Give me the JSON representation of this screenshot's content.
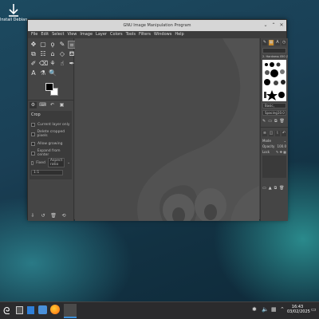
{
  "desktop": {
    "installer_label": "Install Debian"
  },
  "window": {
    "title": "GNU Image Manipulation Program",
    "controls": {
      "minimize": "⌄",
      "maximize": "⌃",
      "close": "✕"
    }
  },
  "menubar": {
    "items": [
      "File",
      "Edit",
      "Select",
      "View",
      "Image",
      "Layer",
      "Colors",
      "Tools",
      "Filters",
      "Windows",
      "Help"
    ]
  },
  "toolbox": {
    "tools": [
      {
        "icon": "move-icon",
        "glyph": "✥"
      },
      {
        "icon": "rect-select-icon",
        "glyph": "▢"
      },
      {
        "icon": "lasso-icon",
        "glyph": "ϙ"
      },
      {
        "icon": "fuzzy-select-icon",
        "glyph": "✎"
      },
      {
        "icon": "crop-icon",
        "glyph": "⌗",
        "active": true
      },
      {
        "icon": "unified-transform-icon",
        "glyph": "⧉"
      },
      {
        "icon": "warp-icon",
        "glyph": "☷"
      },
      {
        "icon": "cage-icon",
        "glyph": "⌂"
      },
      {
        "icon": "perspective-icon",
        "glyph": "◇"
      },
      {
        "icon": "bucket-fill-icon",
        "glyph": "⛾"
      },
      {
        "icon": "paintbrush-icon",
        "glyph": "✐"
      },
      {
        "icon": "eraser-icon",
        "glyph": "⌫"
      },
      {
        "icon": "clone-icon",
        "glyph": "⚘"
      },
      {
        "icon": "smudge-icon",
        "glyph": "☝"
      },
      {
        "icon": "paths-icon",
        "glyph": "✒"
      },
      {
        "icon": "text-icon",
        "glyph": "A"
      },
      {
        "icon": "color-picker-icon",
        "glyph": "⚗"
      },
      {
        "icon": "zoom-icon",
        "glyph": "🔍"
      }
    ],
    "fg_color": "#000000",
    "bg_color": "#ffffff",
    "tool_options": {
      "title": "Crop",
      "options": [
        "Current layer only",
        "Delete cropped pixels",
        "Allow growing",
        "Expand from center"
      ],
      "fixed_label": "Fixed",
      "fixed_value": "Aspect ratio",
      "ratio": "1:1"
    }
  },
  "right_dock": {
    "brush_name": "2. Hardness 050 (51 × 51)",
    "preset": "Basic,",
    "spacing_label": "Spacing",
    "spacing_value": "10.0",
    "mode_label": "Mode",
    "opacity_label": "Opacity",
    "opacity_value": "100.0",
    "lock_label": "Lock"
  },
  "taskbar": {
    "time": "16:43",
    "date": "03/02/2025"
  }
}
